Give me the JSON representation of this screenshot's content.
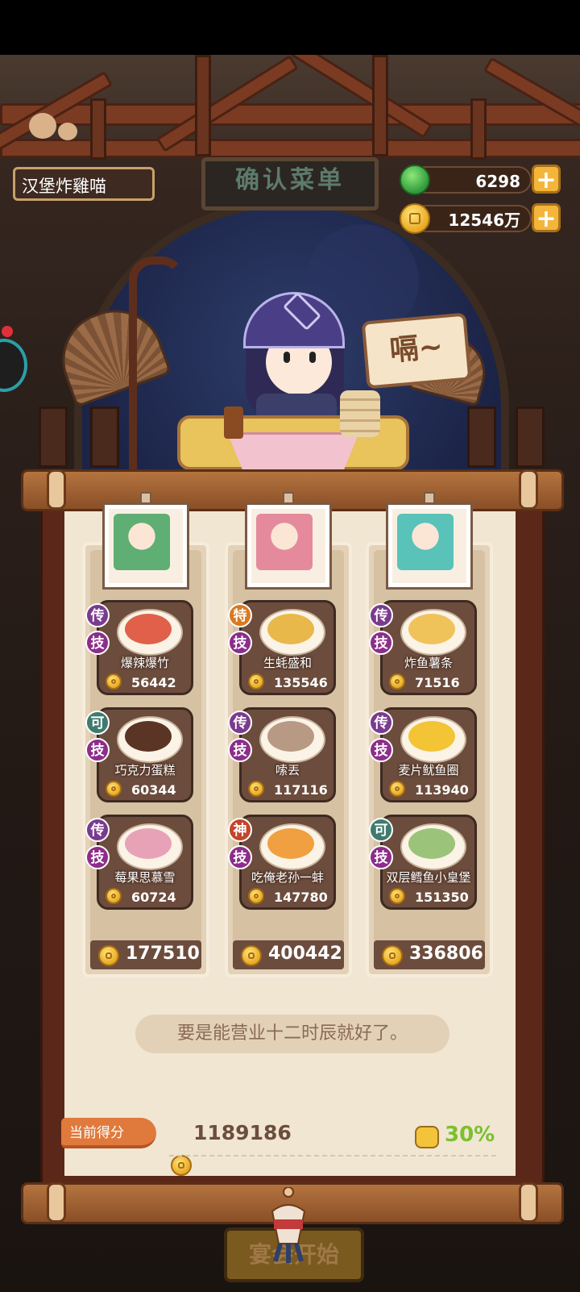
{
  "player": {
    "name": "汉堡炸雞喵"
  },
  "title": {
    "text": "确认菜单"
  },
  "currency": {
    "jade": {
      "value": "6298",
      "icon": "jade-icon"
    },
    "coins": {
      "value": "12546万",
      "icon": "coin-icon"
    },
    "plus_label": "+"
  },
  "speech": {
    "text": "嗝~"
  },
  "columns": [
    {
      "portrait_color": "#5fae73",
      "dishes": [
        {
          "rank": "传",
          "rank_color": "#7a3b8f",
          "skill": "技",
          "name": "爆辣爆竹",
          "price": "56442",
          "food_color": "#e0604a"
        },
        {
          "rank": "可",
          "rank_color": "#3f7a70",
          "skill": "技",
          "name": "巧克力蛋糕",
          "price": "60344",
          "food_color": "#5a3424"
        },
        {
          "rank": "传",
          "rank_color": "#7a3b8f",
          "skill": "技",
          "name": "莓果思慕雪",
          "price": "60724",
          "food_color": "#e7a2b8"
        }
      ],
      "total": "177510"
    },
    {
      "portrait_color": "#e58a9d",
      "dishes": [
        {
          "rank": "特",
          "rank_color": "#d97a20",
          "skill": "技",
          "name": "生蚝盛和",
          "price": "135546",
          "food_color": "#e8b84a"
        },
        {
          "rank": "传",
          "rank_color": "#7a3b8f",
          "skill": "技",
          "name": "嗦丟",
          "price": "117116",
          "food_color": "#b89a84"
        },
        {
          "rank": "神",
          "rank_color": "#c4452a",
          "skill": "技",
          "name": "吃俺老孙一蚌",
          "price": "147780",
          "food_color": "#f0a040"
        }
      ],
      "total": "400442"
    },
    {
      "portrait_color": "#59c2b9",
      "dishes": [
        {
          "rank": "传",
          "rank_color": "#7a3b8f",
          "skill": "技",
          "name": "炸鱼薯条",
          "price": "71516",
          "food_color": "#f0c25a"
        },
        {
          "rank": "传",
          "rank_color": "#7a3b8f",
          "skill": "技",
          "name": "麦片鱿鱼圈",
          "price": "113940",
          "food_color": "#f2c436"
        },
        {
          "rank": "可",
          "rank_color": "#3f7a70",
          "skill": "技",
          "name": "双层鳕鱼小皇堡",
          "price": "151350",
          "food_color": "#9bc47a"
        }
      ],
      "total": "336806"
    }
  ],
  "quote": {
    "text": "要是能营业十二时辰就好了。"
  },
  "score": {
    "label": "当前得分",
    "value": "1189186",
    "percent": "30%"
  },
  "start_button": {
    "label": "宴会开始"
  }
}
